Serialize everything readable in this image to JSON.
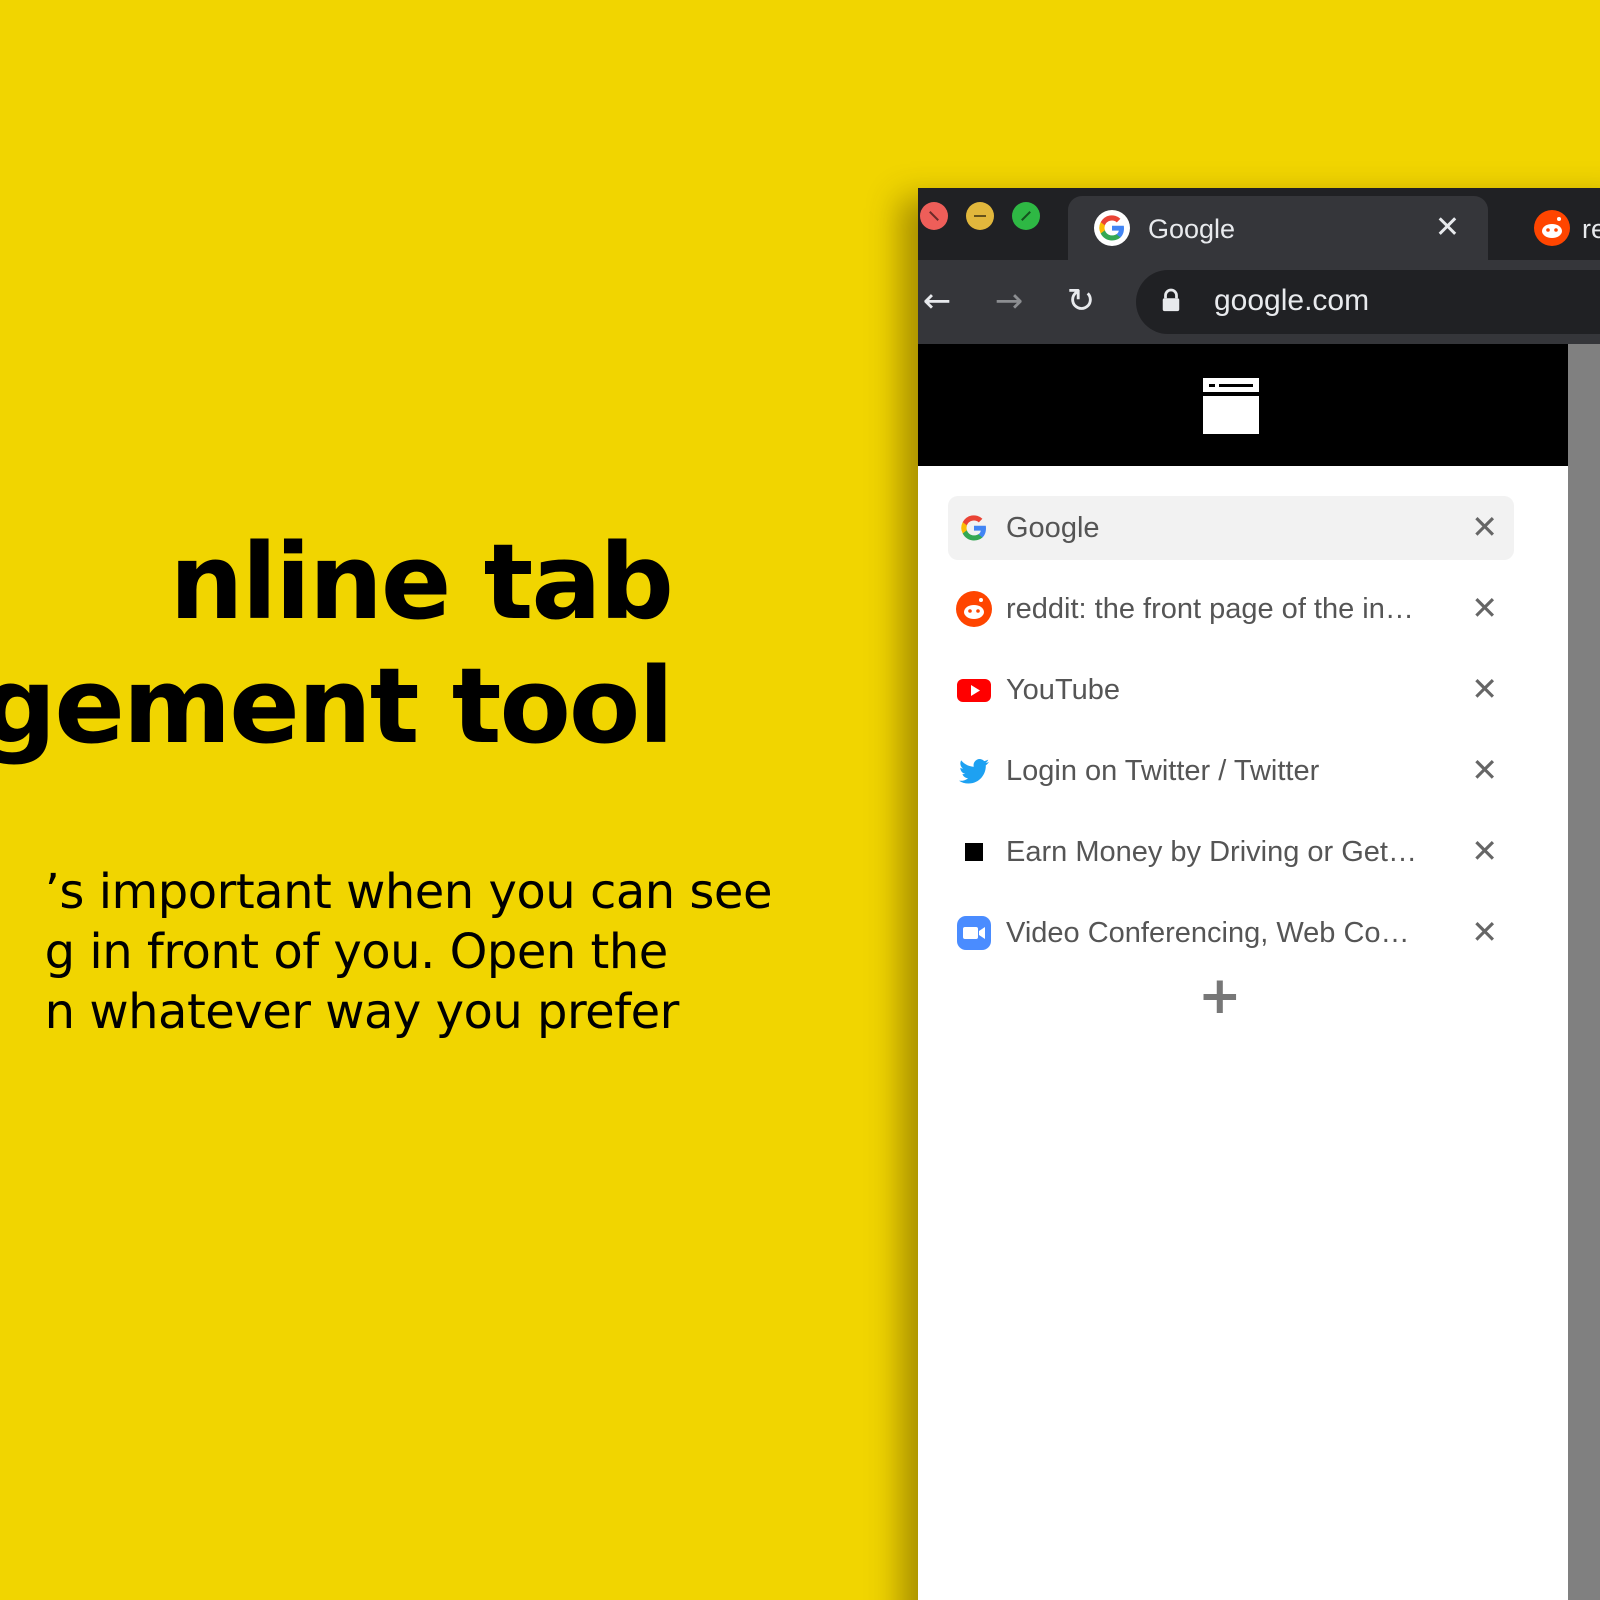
{
  "hero": {
    "headline_line1": "nline tab",
    "headline_line2": "agement tool",
    "body_line1": "’s important when you can see",
    "body_line2": "g in front of you.  Open the",
    "body_line3": "n whatever way you prefer"
  },
  "browser": {
    "active_tab": {
      "title": "Google",
      "close": "✕"
    },
    "next_tab": {
      "title": "red"
    },
    "nav": {
      "back": "←",
      "forward": "→",
      "reload": "↻"
    },
    "omnibox": {
      "url": "google.com"
    }
  },
  "panel": {
    "tabs": [
      {
        "title": "Google",
        "icon": "google-icon",
        "close": "✕"
      },
      {
        "title": "reddit: the front page of the in…",
        "icon": "reddit-icon",
        "close": "✕"
      },
      {
        "title": "YouTube",
        "icon": "youtube-icon",
        "close": "✕"
      },
      {
        "title": "Login on Twitter / Twitter",
        "icon": "twitter-icon",
        "close": "✕"
      },
      {
        "title": "Earn Money by Driving or Get…",
        "icon": "uber-icon",
        "close": "✕"
      },
      {
        "title": "Video Conferencing, Web Co…",
        "icon": "zoom-icon",
        "close": "✕"
      }
    ],
    "add_label": "+"
  },
  "colors": {
    "background": "#f1d500",
    "browser_chrome": "#202124",
    "toolbar": "#35363a",
    "panel_header": "#000000",
    "active_row": "#f2f2f2"
  }
}
